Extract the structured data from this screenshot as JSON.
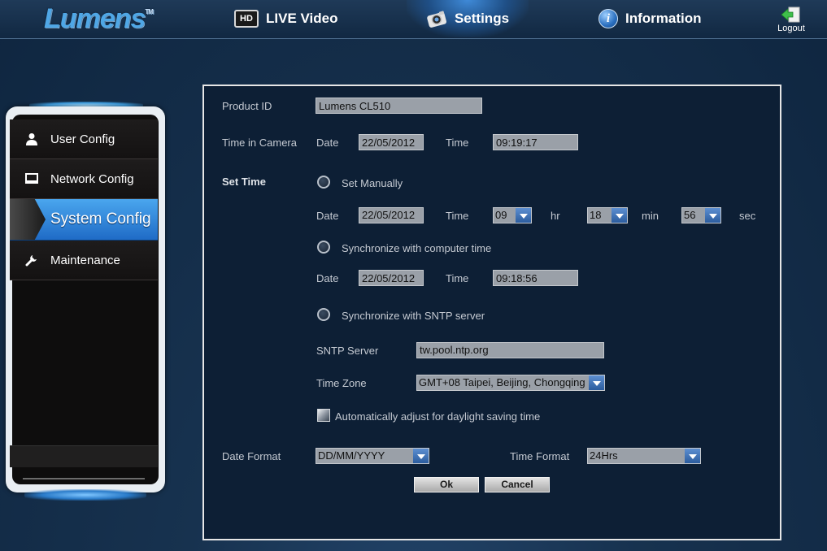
{
  "header": {
    "logo": "Lumens",
    "logo_tm": "TM",
    "nav": [
      {
        "label": "LIVE Video",
        "icon": "hd-icon",
        "icon_text": "HD"
      },
      {
        "label": "Settings",
        "icon": "camera-icon"
      },
      {
        "label": "Information",
        "icon": "info-icon",
        "icon_text": "i"
      }
    ],
    "logout_label": "Logout"
  },
  "sidebar": {
    "items": [
      {
        "label": "User Config",
        "icon": "user-icon"
      },
      {
        "label": "Network Config",
        "icon": "monitor-icon"
      },
      {
        "label": "System Config",
        "icon": "arrow-indicator",
        "active": true
      },
      {
        "label": "Maintenance",
        "icon": "wrench-icon"
      }
    ]
  },
  "form": {
    "product_id_label": "Product ID",
    "product_id_value": "Lumens CL510",
    "time_in_camera_label": "Time in Camera",
    "date_label": "Date",
    "time_label": "Time",
    "camera_date": "22/05/2012",
    "camera_time": "09:19:17",
    "set_time_label": "Set Time",
    "set_manually_label": "Set Manually",
    "manual_date": "22/05/2012",
    "manual_hr": "09",
    "hr_label": "hr",
    "manual_min": "18",
    "min_label": "min",
    "manual_sec": "56",
    "sec_label": "sec",
    "sync_computer_label": "Synchronize with computer time",
    "computer_date": "22/05/2012",
    "computer_time": "09:18:56",
    "sync_sntp_label": "Synchronize with SNTP server",
    "sntp_server_label": "SNTP Server",
    "sntp_server_value": "tw.pool.ntp.org",
    "time_zone_label": "Time Zone",
    "time_zone_value": "GMT+08 Taipei, Beijing, Chongqing",
    "dst_label": "Automatically adjust for daylight saving time",
    "date_format_label": "Date Format",
    "date_format_value": "DD/MM/YYYY",
    "time_format_label": "Time Format",
    "time_format_value": "24Hrs",
    "ok_label": "Ok",
    "cancel_label": "Cancel"
  },
  "colors": {
    "background": "#17324f",
    "accent": "#3f8ad8",
    "panel": "#0d1f35",
    "field": "#9aa0a8"
  }
}
